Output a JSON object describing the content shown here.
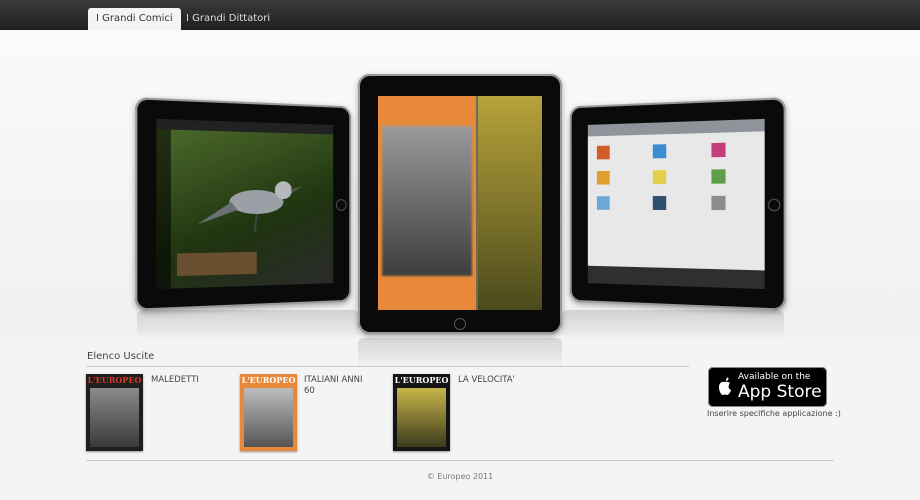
{
  "nav": {
    "tabs": [
      {
        "label": "I Grandi Comici",
        "active": true
      },
      {
        "label": "I Grandi Dittatori",
        "active": false
      }
    ]
  },
  "main": {
    "section_title": "Elenco Uscite",
    "issues": [
      {
        "title": "MALEDETTI",
        "cover_masthead": "L'EUROPEO",
        "cover_color": "#6b6b6b"
      },
      {
        "title": "ITALIANI ANNI 60",
        "cover_masthead": "L'EUROPEO",
        "cover_color": "#e8893a"
      },
      {
        "title": "LA VELOCITA'",
        "cover_masthead": "L'EUROPEO",
        "cover_color": "#2e2e22"
      }
    ]
  },
  "app_store": {
    "badge_small": "Available on the",
    "badge_big": "App Store",
    "caption": "Inserire specifiche applicazione :)"
  },
  "footer": {
    "copyright": "© Europeo 2011"
  },
  "colors": {
    "accent_orange": "#e8893a",
    "nav_dark": "#2a2a2a"
  }
}
